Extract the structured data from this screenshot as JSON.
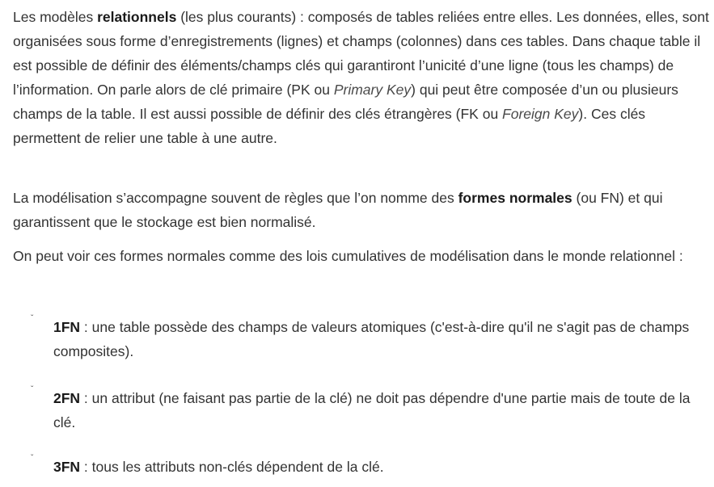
{
  "paragraph1": {
    "prefix": "Les modèles ",
    "bold": "relationnels",
    "mid1": " (les plus courants) : composés de tables reliées entre elles. Les données, elles, sont organisées sous forme d’enregistrements (lignes) et champs (colonnes) dans ces tables. Dans chaque table il est possible de définir des éléments/champs clés qui garantiront l’unicité d’une ligne (tous les champs) de l’information. On parle alors de clé primaire (PK ou ",
    "italic1": "Primary Key",
    "mid2": ") qui peut être composée d’un ou plusieurs champs de la table. Il est aussi possible de définir des clés étrangères (FK ou ",
    "italic2": "Foreign Key",
    "suffix": "). Ces clés permettent de relier une table à une autre."
  },
  "paragraph2": {
    "prefix": "La modélisation s’accompagne souvent de règles que l’on nomme des ",
    "bold": "formes normales",
    "suffix": " (ou FN) et qui garantissent que le stockage est bien normalisé."
  },
  "paragraph3": {
    "text": "On peut voir ces formes normales comme des lois cumulatives de modélisation dans le monde relationnel :"
  },
  "list": {
    "bullet_glyph": "ˇ",
    "items": [
      {
        "bold": "1FN",
        "text": " : une table possède des champs de valeurs atomiques (c'est-à-dire qu'il ne s'agit pas de champs composites)."
      },
      {
        "bold": "2FN",
        "text": " : un attribut (ne faisant pas partie de la clé) ne doit pas dépendre d'une partie mais de toute de la clé."
      },
      {
        "bold": "3FN",
        "text": " : tous les attributs non-clés dépendent de la clé."
      }
    ]
  }
}
